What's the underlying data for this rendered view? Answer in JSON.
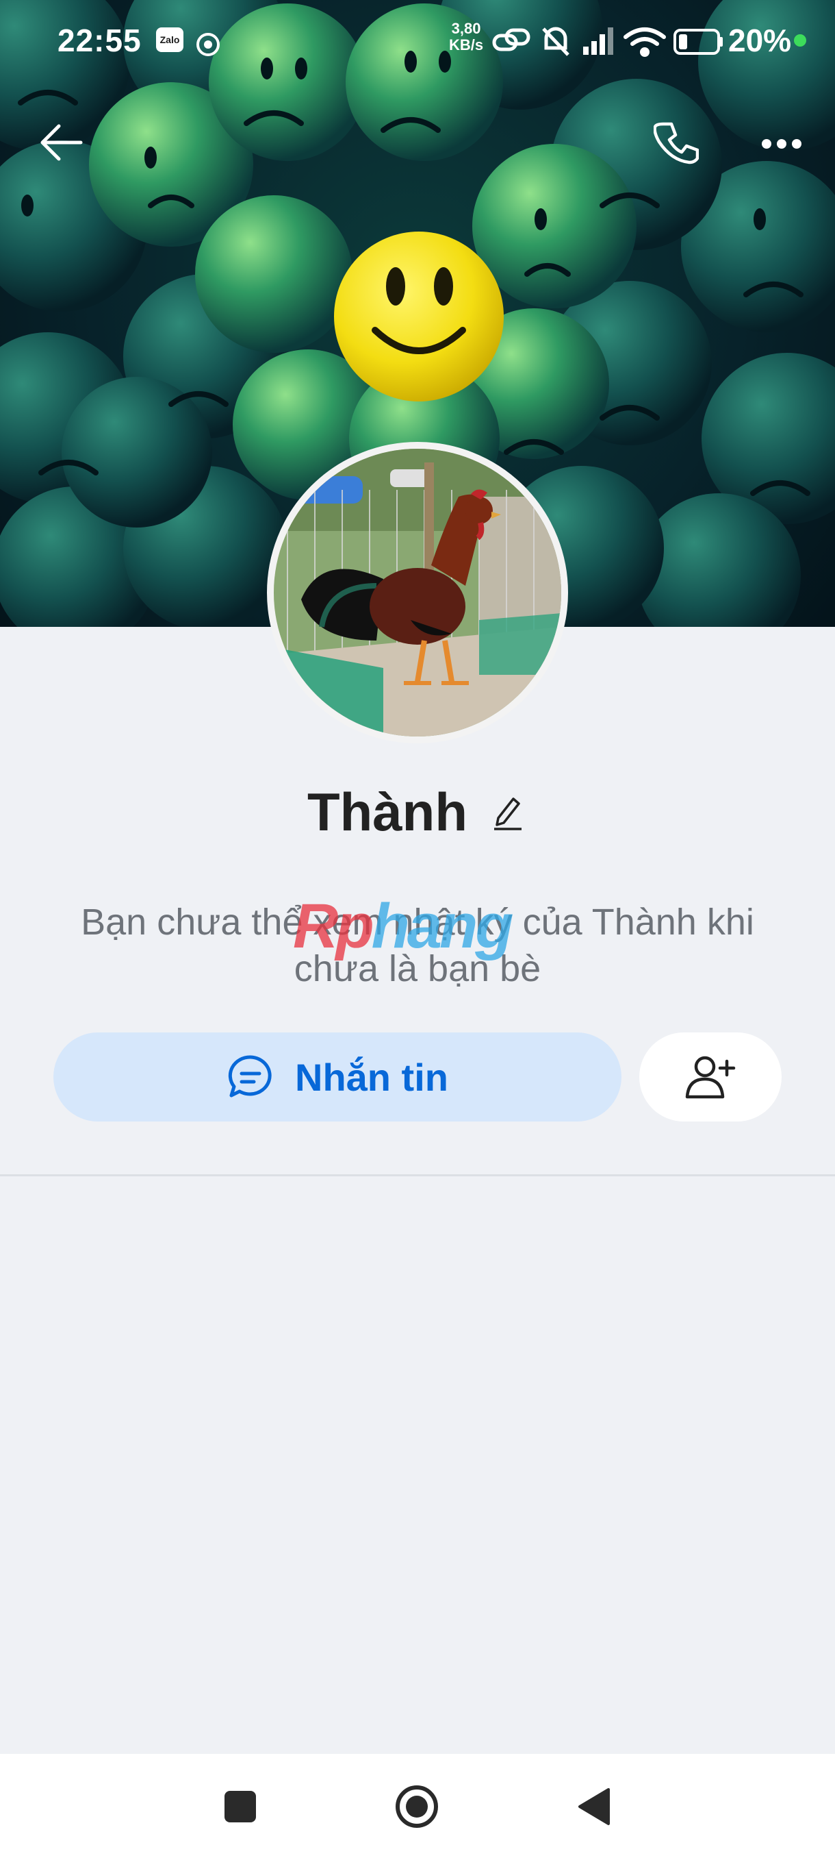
{
  "status_bar": {
    "time": "22:55",
    "app_badge": "Zalo",
    "net_speed_value": "3,80",
    "net_speed_unit": "KB/s",
    "battery_percent": "20%"
  },
  "profile": {
    "name": "Thành",
    "notice": "Bạn chưa thể xem nhật ký của Thành khi chưa là bạn bè"
  },
  "watermark": {
    "part1": "Rp",
    "part2": "hang"
  },
  "actions": {
    "message_label": "Nhắn tin"
  },
  "colors": {
    "accent": "#0868d8",
    "message_button_bg": "#d6e7fb",
    "page_bg": "#eff1f5",
    "battery_dot": "#3ddc5b"
  },
  "icons": {
    "back": "arrow-left-icon",
    "call": "phone-icon",
    "more": "more-horizontal-icon",
    "edit": "pencil-icon",
    "message": "chat-bubble-icon",
    "add_friend": "user-plus-icon"
  }
}
